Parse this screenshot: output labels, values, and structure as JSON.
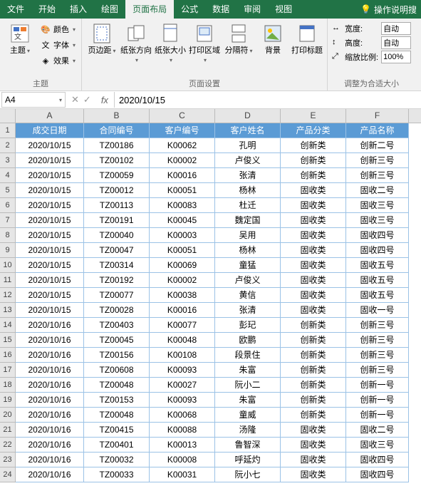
{
  "menu": {
    "file": "文件",
    "home": "开始",
    "insert": "插入",
    "draw": "绘图",
    "layout": "页面布局",
    "formula": "公式",
    "data": "数据",
    "review": "审阅",
    "view": "视图",
    "help_ph": "操作说明搜"
  },
  "ribbon": {
    "theme": {
      "btn": "主题",
      "color": "颜色",
      "font": "字体",
      "effect": "效果",
      "group": "主题"
    },
    "page": {
      "margin": "页边距",
      "orient": "纸张方向",
      "size": "纸张大小",
      "area": "打印区域",
      "breaks": "分隔符",
      "bg": "背景",
      "titles": "打印标题",
      "group": "页面设置"
    },
    "scale": {
      "width": "宽度:",
      "height": "高度:",
      "ratio": "缩放比例:",
      "auto": "自动",
      "pct": "100%",
      "group": "调整为合适大小"
    }
  },
  "namebox": "A4",
  "formula": "2020/10/15",
  "cols": [
    "A",
    "B",
    "C",
    "D",
    "E",
    "F"
  ],
  "headers": [
    "成交日期",
    "合同编号",
    "客户编号",
    "客户姓名",
    "产品分类",
    "产品名称"
  ],
  "rows": [
    [
      "2020/10/15",
      "TZ00186",
      "K00062",
      "孔明",
      "创新类",
      "创新二号"
    ],
    [
      "2020/10/15",
      "TZ00102",
      "K00002",
      "卢俊义",
      "创新类",
      "创新三号"
    ],
    [
      "2020/10/15",
      "TZ00059",
      "K00016",
      "张清",
      "创新类",
      "创新三号"
    ],
    [
      "2020/10/15",
      "TZ00012",
      "K00051",
      "杨林",
      "固收类",
      "固收二号"
    ],
    [
      "2020/10/15",
      "TZ00113",
      "K00083",
      "杜迁",
      "固收类",
      "固收三号"
    ],
    [
      "2020/10/15",
      "TZ00191",
      "K00045",
      "魏定国",
      "固收类",
      "固收三号"
    ],
    [
      "2020/10/15",
      "TZ00040",
      "K00003",
      "吴用",
      "固收类",
      "固收四号"
    ],
    [
      "2020/10/15",
      "TZ00047",
      "K00051",
      "杨林",
      "固收类",
      "固收四号"
    ],
    [
      "2020/10/15",
      "TZ00314",
      "K00069",
      "童猛",
      "固收类",
      "固收五号"
    ],
    [
      "2020/10/15",
      "TZ00192",
      "K00002",
      "卢俊义",
      "固收类",
      "固收五号"
    ],
    [
      "2020/10/15",
      "TZ00077",
      "K00038",
      "黄信",
      "固收类",
      "固收五号"
    ],
    [
      "2020/10/15",
      "TZ00028",
      "K00016",
      "张清",
      "固收类",
      "固收一号"
    ],
    [
      "2020/10/16",
      "TZ00403",
      "K00077",
      "彭玘",
      "创新类",
      "创新三号"
    ],
    [
      "2020/10/16",
      "TZ00045",
      "K00048",
      "欧鹏",
      "创新类",
      "创新三号"
    ],
    [
      "2020/10/16",
      "TZ00156",
      "K00108",
      "段景住",
      "创新类",
      "创新三号"
    ],
    [
      "2020/10/16",
      "TZ00608",
      "K00093",
      "朱富",
      "创新类",
      "创新三号"
    ],
    [
      "2020/10/16",
      "TZ00048",
      "K00027",
      "阮小二",
      "创新类",
      "创新一号"
    ],
    [
      "2020/10/16",
      "TZ00153",
      "K00093",
      "朱富",
      "创新类",
      "创新一号"
    ],
    [
      "2020/10/16",
      "TZ00048",
      "K00068",
      "童威",
      "创新类",
      "创新一号"
    ],
    [
      "2020/10/16",
      "TZ00415",
      "K00088",
      "汤隆",
      "固收类",
      "固收二号"
    ],
    [
      "2020/10/16",
      "TZ00401",
      "K00013",
      "鲁智深",
      "固收类",
      "固收三号"
    ],
    [
      "2020/10/16",
      "TZ00032",
      "K00008",
      "呼延灼",
      "固收类",
      "固收四号"
    ],
    [
      "2020/10/16",
      "TZ00033",
      "K00031",
      "阮小七",
      "固收类",
      "固收四号"
    ]
  ]
}
